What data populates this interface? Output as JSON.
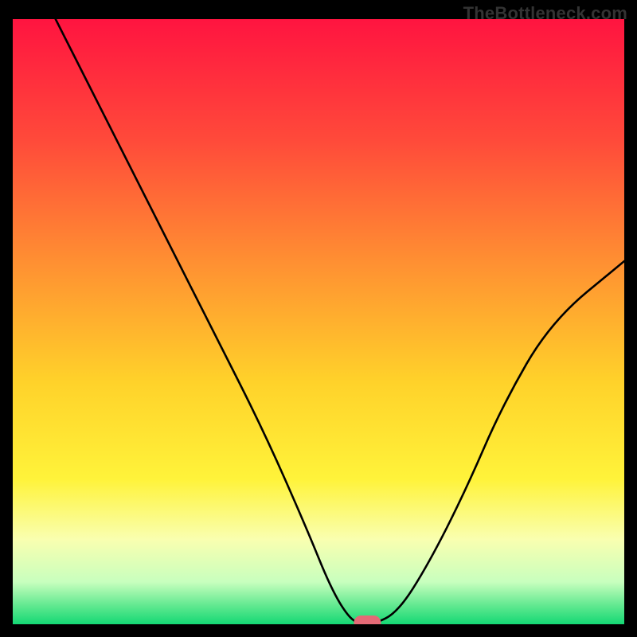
{
  "watermark": "TheBottleneck.com",
  "chart_data": {
    "type": "line",
    "title": "",
    "xlabel": "",
    "ylabel": "",
    "xlim": [
      0,
      100
    ],
    "ylim": [
      0,
      100
    ],
    "grid": false,
    "series": [
      {
        "name": "curve",
        "x": [
          7,
          12,
          18,
          25,
          33,
          41,
          48,
          52,
          55,
          57,
          59,
          63,
          68,
          74,
          80,
          88,
          100
        ],
        "y": [
          100,
          90,
          78,
          64,
          48,
          32,
          16,
          6,
          1,
          0,
          0,
          2,
          10,
          22,
          36,
          50,
          60
        ]
      }
    ],
    "marker": {
      "x": 58,
      "y": 0
    },
    "gradient_stops": [
      {
        "offset": 0,
        "color": "#ff1440"
      },
      {
        "offset": 20,
        "color": "#ff4a3a"
      },
      {
        "offset": 40,
        "color": "#ff8f32"
      },
      {
        "offset": 60,
        "color": "#ffd22a"
      },
      {
        "offset": 76,
        "color": "#fff33a"
      },
      {
        "offset": 86,
        "color": "#f9ffb0"
      },
      {
        "offset": 93,
        "color": "#c8ffbe"
      },
      {
        "offset": 97,
        "color": "#5fe88f"
      },
      {
        "offset": 100,
        "color": "#14d874"
      }
    ],
    "marker_color": "#e46a76",
    "line_color": "#000000"
  }
}
